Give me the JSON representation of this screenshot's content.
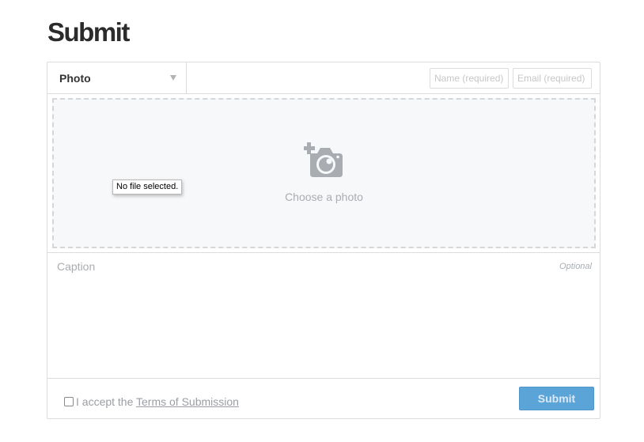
{
  "page": {
    "title": "Submit"
  },
  "form": {
    "type_select": {
      "selected": "Photo"
    },
    "name_field": {
      "value": "",
      "placeholder": "Name (required)"
    },
    "email_field": {
      "value": "",
      "placeholder": "Email (required)"
    },
    "dropzone": {
      "icon": "camera-plus-icon",
      "label": "Choose a photo",
      "tooltip": "No file selected."
    },
    "caption": {
      "value": "",
      "placeholder": "Caption",
      "optional_label": "Optional"
    },
    "footer": {
      "accept_prefix": "I accept the ",
      "terms_link": "Terms of Submission",
      "accept_checked": false,
      "submit_label": "Submit"
    }
  },
  "colors": {
    "accent": "#5ba4d8",
    "border": "#dcdcdc",
    "muted_text": "#a9adb2",
    "dropzone_bg": "#f7f8f9"
  }
}
